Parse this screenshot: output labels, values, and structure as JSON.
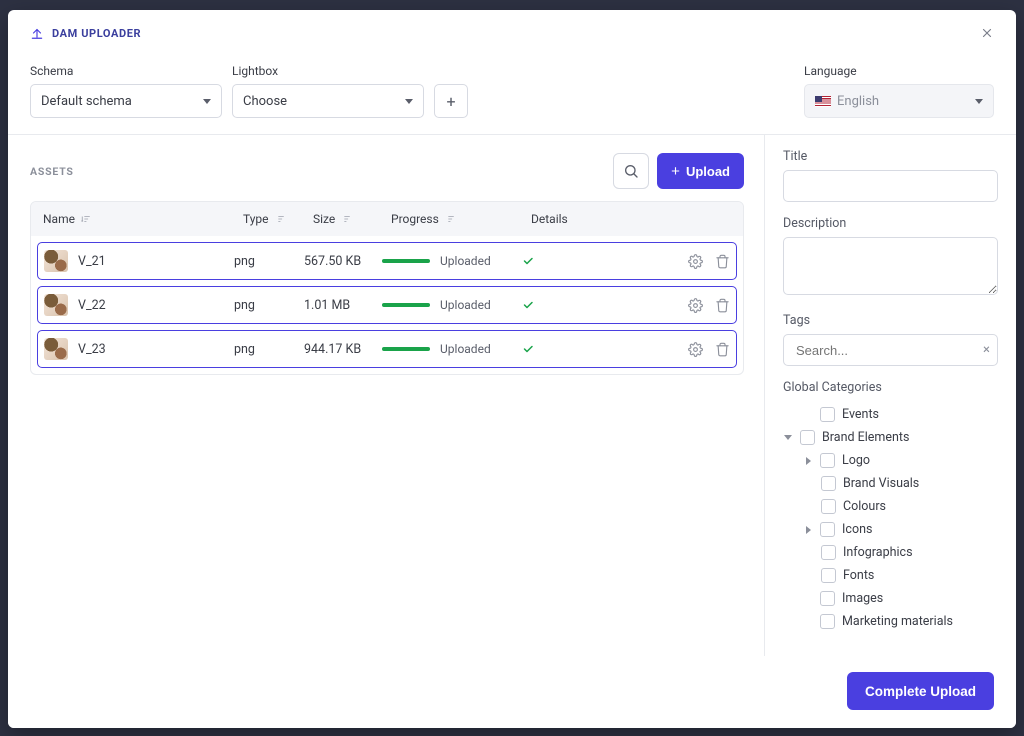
{
  "header": {
    "title": "DAM UPLOADER"
  },
  "filters": {
    "schemaLabel": "Schema",
    "schemaValue": "Default schema",
    "lightboxLabel": "Lightbox",
    "lightboxValue": "Choose",
    "languageLabel": "Language",
    "languageValue": "English"
  },
  "assets": {
    "sectionTitle": "ASSETS",
    "uploadLabel": "Upload",
    "columns": {
      "name": "Name",
      "type": "Type",
      "size": "Size",
      "progress": "Progress",
      "details": "Details"
    },
    "rows": [
      {
        "name": "V_21",
        "type": "png",
        "size": "567.50 KB",
        "status": "Uploaded"
      },
      {
        "name": "V_22",
        "type": "png",
        "size": "1.01 MB",
        "status": "Uploaded"
      },
      {
        "name": "V_23",
        "type": "png",
        "size": "944.17 KB",
        "status": "Uploaded"
      }
    ]
  },
  "sidePanel": {
    "titleLabel": "Title",
    "descriptionLabel": "Description",
    "tagsLabel": "Tags",
    "tagsPlaceholder": "Search...",
    "categoriesLabel": "Global Categories",
    "categories": [
      {
        "label": "Events"
      },
      {
        "label": "Brand Elements"
      },
      {
        "label": "Logo"
      },
      {
        "label": "Brand Visuals"
      },
      {
        "label": "Colours"
      },
      {
        "label": "Icons"
      },
      {
        "label": "Infographics"
      },
      {
        "label": "Fonts"
      },
      {
        "label": "Images"
      },
      {
        "label": "Marketing materials"
      }
    ]
  },
  "footer": {
    "completeLabel": "Complete Upload"
  }
}
